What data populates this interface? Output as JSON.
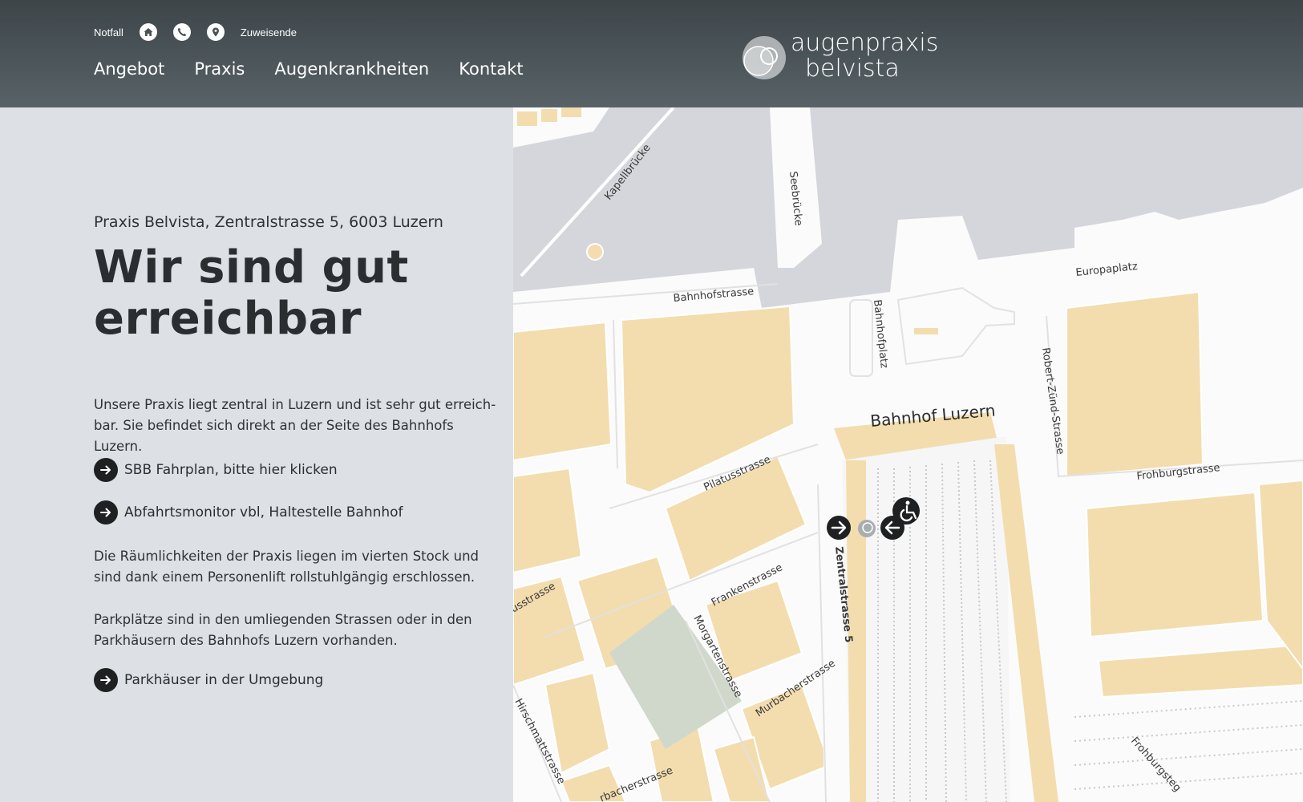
{
  "header": {
    "topbar": {
      "notfall": "Notfall",
      "zuweisende": "Zuweisende",
      "icons": [
        "home-icon",
        "phone-icon",
        "location-pin-icon"
      ]
    },
    "nav": [
      "Angebot",
      "Praxis",
      "Augenkrankheiten",
      "Kontakt"
    ],
    "logo": {
      "line1": "augenpraxis",
      "line2": "belvista"
    }
  },
  "main": {
    "address": "Praxis Belvista, Zentralstrasse 5, 6003 Luzern",
    "headline_line1": "Wir sind gut",
    "headline_line2": "erreichbar",
    "intro_line1": "Unsere Praxis liegt zentral in Luzern und ist sehr gut erreich-",
    "intro_line2": "bar. Sie befindet sich direkt an der Seite des Bahnhofs Luzern.",
    "link_sbb": "SBB Fahrplan, bitte hier klicken",
    "link_vbl": "Abfahrtsmonitor vbl, Haltestelle Bahnhof",
    "access_line1": "Die Räumlichkeiten der Praxis liegen im vierten Stock und",
    "access_line2": "sind dank einem Personenlift rollstuhlgängig erschlossen.",
    "parking_line1": "Parkplätze sind in den umliegenden Strassen oder in den",
    "parking_line2": "Parkhäusern des Bahnhofs Luzern vorhanden.",
    "link_parking": "Parkhäuser in der Umgebung"
  },
  "map": {
    "labels": {
      "kapellbruecke": "Kapellbrücke",
      "seebruecke": "Seebrücke",
      "bahnhofstrasse": "Bahnhofstrasse",
      "bahnhofplatz": "Bahnhofplatz",
      "europaplatz": "Europaplatz",
      "robert": "Robert-Zünd-Strasse",
      "bahnhof_luzern": "Bahnhof Luzern",
      "pilatusstrasse": "Pilatusstrasse",
      "frohburgstrasse": "Frohburgstrasse",
      "zentralstrasse": "Zentralstrasse 5",
      "frankenstrasse": "Frankenstrasse",
      "morgartenstrasse": "Morgartenstrasse",
      "murbacherstrasse": "Murbacherstrasse",
      "usstrasse": "usstrasse",
      "hirschmattstrasse": "Hirschmattstrasse",
      "rbacherstrasse": "rbacherstrasse",
      "frohburgsteg": "Frohburgsteg"
    },
    "colors": {
      "water": "#d5d6dc",
      "building": "#f3ddae",
      "road": "#ffffff",
      "park": "#cfd8cb"
    }
  }
}
